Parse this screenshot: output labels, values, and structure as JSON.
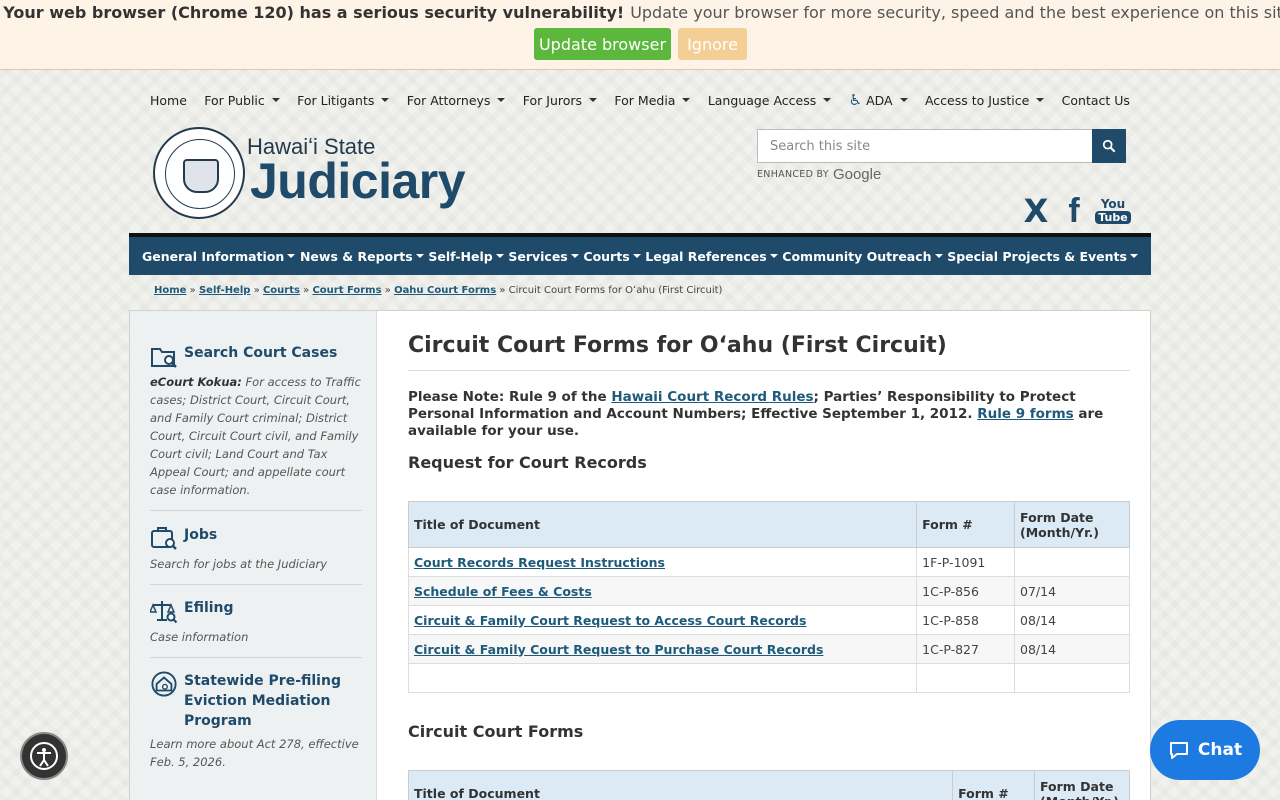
{
  "browser_warning": {
    "bold": "Your web browser (Chrome 120) has a serious security vulnerability!",
    "rest": "Update your browser for more security, speed and the best experience on this site.",
    "update_label": "Update browser",
    "ignore_label": "Ignore"
  },
  "top_nav": [
    {
      "label": "Home",
      "caret": false
    },
    {
      "label": "For Public",
      "caret": true
    },
    {
      "label": "For Litigants",
      "caret": true
    },
    {
      "label": "For Attorneys",
      "caret": true
    },
    {
      "label": "For Jurors",
      "caret": true
    },
    {
      "label": "For Media",
      "caret": true
    },
    {
      "label": "Language Access",
      "caret": true
    },
    {
      "label": "ADA",
      "caret": true
    },
    {
      "label": "Access to Justice",
      "caret": true
    },
    {
      "label": "Contact Us",
      "caret": false
    }
  ],
  "logo": {
    "small": "Hawaiʻi State",
    "big": "Judiciary"
  },
  "search": {
    "placeholder": "Search this site",
    "enhanced": "ENHANCED BY",
    "google": "Google"
  },
  "social": {
    "x": "X",
    "facebook": "f",
    "youtube_you": "You",
    "youtube_tube": "Tube"
  },
  "main_nav": [
    "General Information",
    "News & Reports",
    "Self-Help",
    "Services",
    "Courts",
    "Legal References",
    "Community Outreach",
    "Special Projects & Events"
  ],
  "breadcrumb": {
    "links": [
      "Home",
      "Self-Help",
      "Courts",
      "Court Forms",
      "Oahu Court Forms"
    ],
    "separator": "»",
    "current": "Circuit Court Forms for Oʻahu (First Circuit)"
  },
  "sidebar": {
    "search_court_cases": {
      "title": "Search Court Cases",
      "desc_bold": "eCourt Kokua:",
      "desc": "For access to Traffic cases; District Court, Circuit Court, and Family Court criminal; District Court, Circuit Court civil, and Family Court civil; Land Court and Tax Appeal Court; and appellate court case information."
    },
    "jobs": {
      "title": "Jobs",
      "desc": "Search for jobs at the Judiciary"
    },
    "efiling": {
      "title": "Efiling",
      "desc": "Case information"
    },
    "eviction": {
      "title": "Statewide Pre-filing Eviction Mediation Program",
      "desc": "Learn more about Act 278, effective Feb. 5, 2026."
    }
  },
  "page": {
    "title": "Circuit Court Forms for Oʻahu (First Circuit)",
    "note_1": "Please Note: Rule 9 of the ",
    "note_link1": "Hawaii Court Record Rules",
    "note_2": "; Parties’ Responsibility to Protect Personal Information and Account Numbers; Effective September 1, 2012. ",
    "note_link2": "Rule 9 forms",
    "note_3": " are available for your use."
  },
  "records_section": {
    "title": "Request for Court Records",
    "headers": [
      "Title of Document",
      "Form #",
      "Form Date (Month/Yr.)"
    ],
    "rows": [
      {
        "title": "Court Records Request Instructions",
        "form": "1F-P-1091",
        "date": ""
      },
      {
        "title": "Schedule of Fees & Costs",
        "form": "1C-P-856",
        "date": "07/14"
      },
      {
        "title": "Circuit & Family Court Request to Access Court Records",
        "form": "1C-P-858",
        "date": "08/14"
      },
      {
        "title": "Circuit & Family Court Request to Purchase Court Records",
        "form": "1C-P-827",
        "date": "08/14"
      },
      {
        "title": "",
        "form": "",
        "date": ""
      }
    ]
  },
  "circuit_section": {
    "title": "Circuit Court Forms",
    "headers": [
      "Title of Document",
      "Form #",
      "Form Date (Month/Yr.)"
    ]
  },
  "chat": {
    "label": "Chat"
  },
  "colors": {
    "brand": "#1f4a6a",
    "update_green": "#5cb83c",
    "chat_blue": "#1d7ae0",
    "table_header": "#dbeaf4"
  }
}
